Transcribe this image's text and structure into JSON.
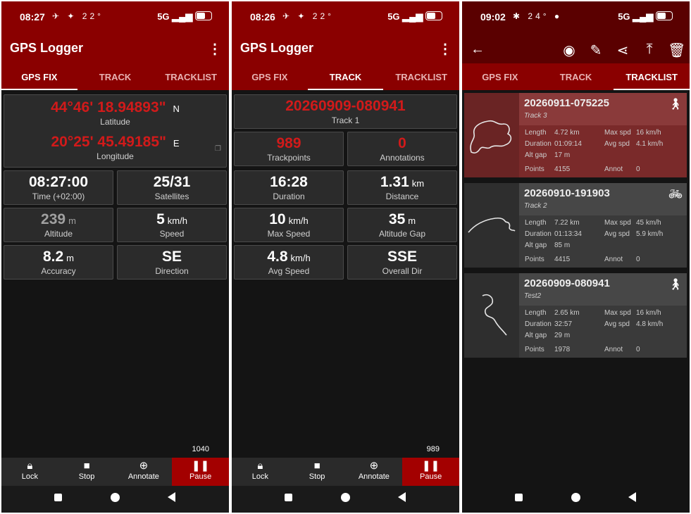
{
  "screens": [
    {
      "status": {
        "time": "08:27",
        "icons": "✈ ✦ 22°",
        "right": "5G"
      },
      "app": {
        "title": "GPS Logger",
        "menu_icon": "more-vert-icon"
      },
      "tabs": [
        "GPS FIX",
        "TRACK",
        "TRACKLIST"
      ],
      "active_tab": 0,
      "fix": {
        "lat_value": "44°46' 18.94893\"",
        "lat_dir": "N",
        "lat_label": "Latitude",
        "lon_value": "20°25' 45.49185\"",
        "lon_dir": "E",
        "lon_label": "Longitude",
        "time_value": "08:27:00",
        "time_label": "Time (+02:00)",
        "sat_value": "25/31",
        "sat_label": "Satellites",
        "alt_value": "239",
        "alt_unit": "m",
        "alt_label": "Altitude",
        "speed_value": "5",
        "speed_unit": "km/h",
        "speed_label": "Speed",
        "acc_value": "8.2",
        "acc_unit": "m",
        "acc_label": "Accuracy",
        "dir_value": "SE",
        "dir_label": "Direction"
      },
      "count": "1040",
      "bottom": [
        "Lock",
        "Stop",
        "Annotate",
        "Pause"
      ]
    },
    {
      "status": {
        "time": "08:26",
        "icons": "✈ ✦ 22°",
        "right": "5G"
      },
      "app": {
        "title": "GPS Logger",
        "menu_icon": "more-vert-icon"
      },
      "tabs": [
        "GPS FIX",
        "TRACK",
        "TRACKLIST"
      ],
      "active_tab": 1,
      "track": {
        "name": "20260909-080941",
        "desc": "Track 1",
        "trackpoints_value": "989",
        "trackpoints_label": "Trackpoints",
        "annotations_value": "0",
        "annotations_label": "Annotations",
        "duration_value": "16:28",
        "duration_label": "Duration",
        "distance_value": "1.31",
        "distance_unit": "km",
        "distance_label": "Distance",
        "maxspeed_value": "10",
        "maxspeed_unit": "km/h",
        "maxspeed_label": "Max Speed",
        "altgap_value": "35",
        "altgap_unit": "m",
        "altgap_label": "Altitude Gap",
        "avgspeed_value": "4.8",
        "avgspeed_unit": "km/h",
        "avgspeed_label": "Avg Speed",
        "overall_value": "SSE",
        "overall_label": "Overall Dir"
      },
      "count": "989",
      "bottom": [
        "Lock",
        "Stop",
        "Annotate",
        "Pause"
      ]
    },
    {
      "status": {
        "time": "09:02",
        "icons": "✱ 24° ●",
        "right": "5G"
      },
      "tabs": [
        "GPS FIX",
        "TRACK",
        "TRACKLIST"
      ],
      "active_tab": 2,
      "toolbar_icons": [
        "back-arrow-icon",
        "eye-icon",
        "edit-icon",
        "share-icon",
        "upload-icon",
        "delete-icon"
      ],
      "labels": {
        "length": "Length",
        "duration": "Duration",
        "altgap": "Alt gap",
        "points": "Points",
        "maxspd": "Max spd",
        "avgspd": "Avg spd",
        "annot": "Annot"
      },
      "tracks": [
        {
          "name": "20260911-075225",
          "desc": "Track 3",
          "activity": "walk-icon",
          "length": "4.72 km",
          "duration": "01:09:14",
          "altgap": "17 m",
          "points": "4155",
          "maxspd": "16 km/h",
          "avgspd": "4.1 km/h",
          "annot": "0",
          "selected": true
        },
        {
          "name": "20260910-191903",
          "desc": "Track 2",
          "activity": "bike-icon",
          "length": "7.22 km",
          "duration": "01:13:34",
          "altgap": "85 m",
          "points": "4415",
          "maxspd": "45 km/h",
          "avgspd": "5.9 km/h",
          "annot": "0",
          "selected": false
        },
        {
          "name": "20260909-080941",
          "desc": "Test2",
          "activity": "walk-icon",
          "length": "2.65 km",
          "duration": "32:57",
          "altgap": "29 m",
          "points": "1978",
          "maxspd": "16 km/h",
          "avgspd": "4.8 km/h",
          "annot": "0",
          "selected": false
        }
      ]
    }
  ],
  "colors": {
    "accent": "#8a0000",
    "value_red": "#d11a1a",
    "card_bg": "#2b2b2b",
    "pause_bg": "#a30000"
  }
}
